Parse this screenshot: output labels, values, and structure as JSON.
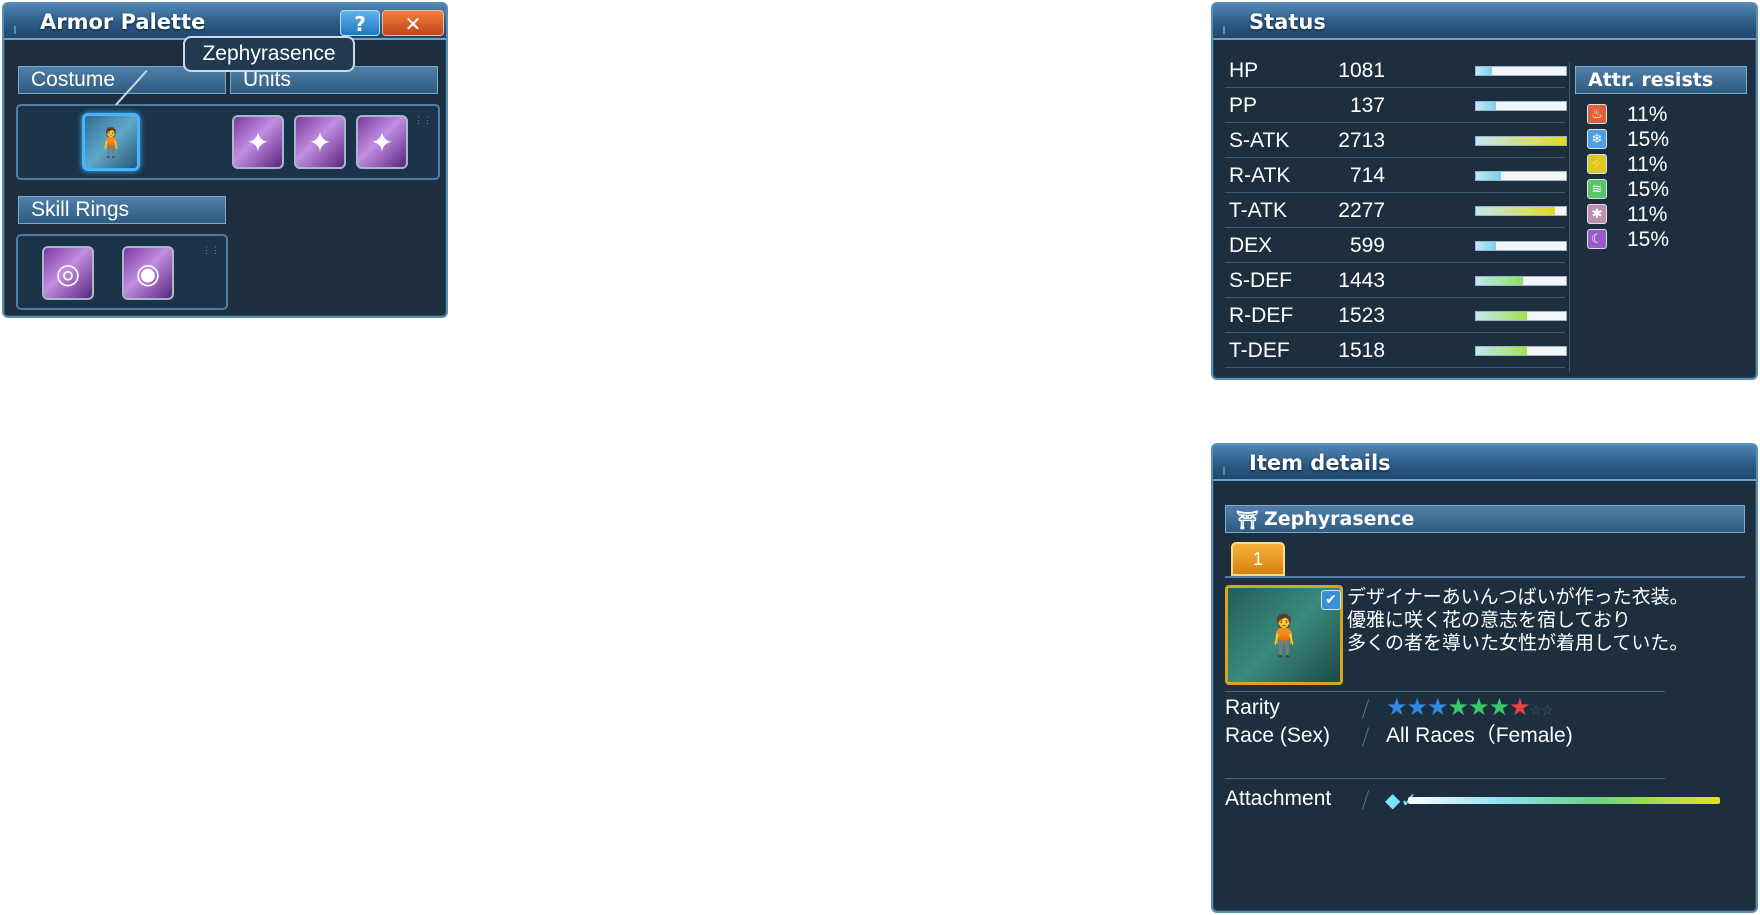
{
  "armor_palette": {
    "title": "Armor Palette",
    "help_label": "?",
    "close_label": "✕",
    "tooltip": "Zephyrasence",
    "costume_tab": "Costume",
    "units_tab": "Units",
    "skill_rings_tab": "Skill Rings"
  },
  "status": {
    "title": "Status",
    "stats": [
      {
        "name": "HP",
        "value": "1081",
        "level": 0.18,
        "color": "#7ad0ea"
      },
      {
        "name": "PP",
        "value": "137",
        "level": 0.22,
        "color": "#7ad0ea"
      },
      {
        "name": "S-ATK",
        "value": "2713",
        "level": 1.0,
        "color": "#e6d81f"
      },
      {
        "name": "R-ATK",
        "value": "714",
        "level": 0.28,
        "color": "#7ad0ea"
      },
      {
        "name": "T-ATK",
        "value": "2277",
        "level": 0.88,
        "color": "#e6d81f"
      },
      {
        "name": "DEX",
        "value": "599",
        "level": 0.22,
        "color": "#7ad0ea"
      },
      {
        "name": "S-DEF",
        "value": "1443",
        "level": 0.52,
        "color": "#8ee05a"
      },
      {
        "name": "R-DEF",
        "value": "1523",
        "level": 0.57,
        "color": "#a8e04a"
      },
      {
        "name": "T-DEF",
        "value": "1518",
        "level": 0.57,
        "color": "#a8e04a"
      }
    ],
    "attr_header": "Attr. resists",
    "resists": [
      {
        "icon": "fire-resist-icon",
        "glyph": "♨",
        "color": "#e0603a",
        "value": "11%"
      },
      {
        "icon": "ice-resist-icon",
        "glyph": "❄",
        "color": "#4aa0e0",
        "value": "15%"
      },
      {
        "icon": "lightning-resist-icon",
        "glyph": "⚡",
        "color": "#d8c82a",
        "value": "11%"
      },
      {
        "icon": "wind-resist-icon",
        "glyph": "≋",
        "color": "#5ac46a",
        "value": "15%"
      },
      {
        "icon": "light-resist-icon",
        "glyph": "✱",
        "color": "#c08fb0",
        "value": "11%"
      },
      {
        "icon": "dark-resist-icon",
        "glyph": "☾",
        "color": "#9a5ac8",
        "value": "15%"
      }
    ]
  },
  "item_details": {
    "title": "Item details",
    "item_name": "Zephyrasence",
    "tab_label": "1",
    "description": [
      "デザイナーあいんつばいが作った衣装。",
      "優雅に咲く花の意志を宿しており",
      "多くの者を導いた女性が着用していた。"
    ],
    "rarity_label": "Rarity",
    "rarity_stars": 7,
    "rarity_max": 9,
    "star_colors": [
      "#2f8ae0",
      "#2f8ae0",
      "#2f8ae0",
      "#3bc86a",
      "#3bc86a",
      "#3bc86a",
      "#e8453a"
    ],
    "race_label": "Race (Sex)",
    "race_value": "All Races（Female)",
    "attachment_label": "Attachment"
  }
}
